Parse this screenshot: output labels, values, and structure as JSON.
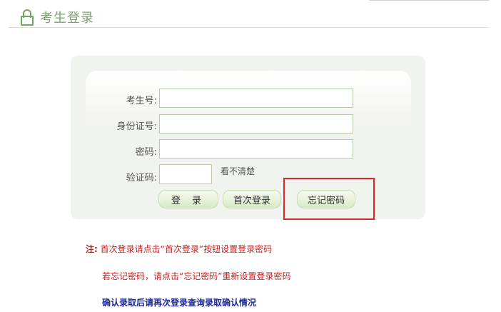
{
  "header": {
    "title": "考生登录",
    "icon": "lock-icon",
    "accent_color": "#7aa56d"
  },
  "form": {
    "labels": {
      "exam_no": "考生号:",
      "id_no": "身份证号:",
      "password": "密码:",
      "captcha": "验证码:"
    },
    "values": {
      "exam_no": "",
      "id_no": "",
      "password": "",
      "captcha": ""
    },
    "unclear_link": "看不清楚",
    "buttons": {
      "login": "登 录",
      "first_login": "首次登录",
      "forgot_password": "忘记密码"
    }
  },
  "notes": {
    "prefix": "注:",
    "line1": "首次登录请点击“首次登录”按钮设置登录密码",
    "line2": "若忘记密码，请点击“忘记密码”重新设置登录密码",
    "line3": "确认录取后请再次登录查询录取确认情况",
    "colors": {
      "warn": "#c81e1e",
      "info": "#1a2a9c"
    }
  },
  "highlight_color": "#e02525"
}
